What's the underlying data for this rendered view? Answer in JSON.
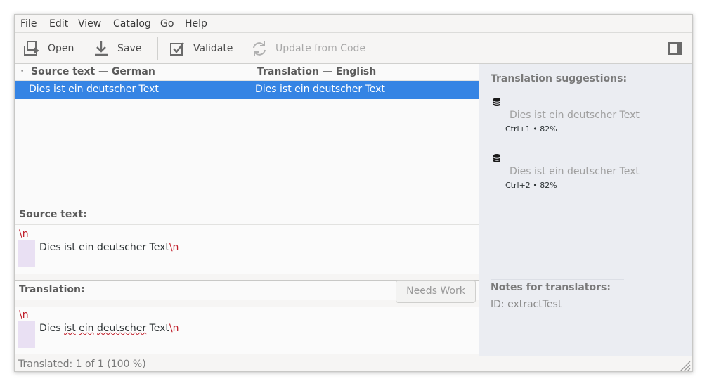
{
  "menu": [
    "File",
    "Edit",
    "View",
    "Catalog",
    "Go",
    "Help"
  ],
  "toolbar": {
    "open_label": "Open",
    "save_label": "Save",
    "validate_label": "Validate",
    "update_label": "Update from Code"
  },
  "list": {
    "col_source": "Source text — German",
    "col_translation": "Translation — English",
    "rows": [
      {
        "source": "Dies ist ein deutscher Text",
        "translation": "Dies ist ein deutscher Text"
      }
    ]
  },
  "source_pane": {
    "label": "Source text:",
    "newline_marker": "\\n",
    "text": "Dies ist ein deutscher Text"
  },
  "translation_pane": {
    "label": "Translation:",
    "newline_marker": "\\n",
    "text_words": [
      "Dies",
      "ist",
      "ein",
      "deutscher",
      "Text"
    ],
    "needs_work_label": "Needs Work"
  },
  "sidebar": {
    "suggestions_title": "Translation suggestions:",
    "suggestions": [
      {
        "text": "Dies ist ein deutscher Text",
        "shortcut": "Ctrl+1",
        "score": "82%"
      },
      {
        "text": "Dies ist ein deutscher Text",
        "shortcut": "Ctrl+2",
        "score": "82%"
      }
    ],
    "notes_title": "Notes for translators:",
    "notes_id": "ID: extractTest"
  },
  "status": "Translated: 1 of 1 (100 %)",
  "colors": {
    "selection": "#3584e4",
    "newline": "#c01c28",
    "sidebar_bg": "#ebedf2"
  }
}
